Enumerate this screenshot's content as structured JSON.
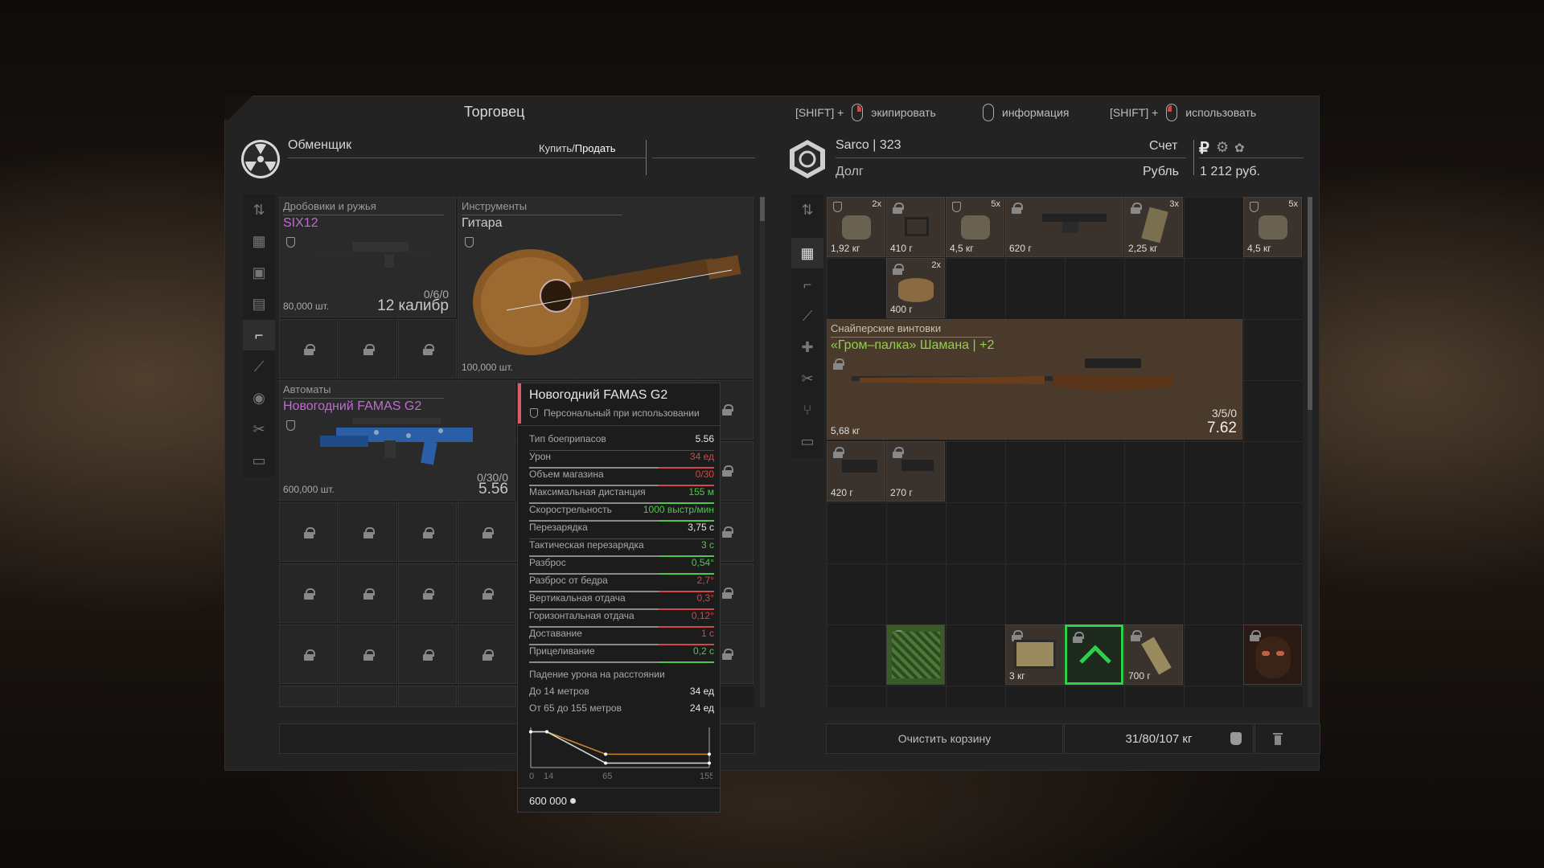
{
  "header": {
    "title": "Торговец",
    "hint1_key": "[SHIFT] +",
    "hint1_label": "экипировать",
    "hint2_label": "информация",
    "hint3_key": "[SHIFT] +",
    "hint3_label": "использовать"
  },
  "left": {
    "trader_name": "Обменщик",
    "tab_buy": "Купить",
    "tab_sep": "/",
    "tab_sell": "Продать"
  },
  "right": {
    "player": "Sarco | 323",
    "account_label": "Счет",
    "debt_label": "Долг",
    "currency": "Рубль",
    "money": "1 212 руб.",
    "currency_symbol": "₽"
  },
  "shop": [
    {
      "category": "Дробовики и ружья",
      "name": "SIX12",
      "name_color": "#c06bd0",
      "price": "80,000 шт.",
      "ammo_counts": "0/6/0",
      "caliber": "12 калибр"
    },
    {
      "category": "Инструменты",
      "name": "Гитара",
      "name_color": "#cccccc",
      "price": "100,000 шт."
    },
    {
      "category": "Автоматы",
      "name": "Новогодний FAMAS G2",
      "name_color": "#c06bd0",
      "price": "600,000 шт.",
      "ammo_counts": "0/30/0",
      "caliber": "5.56"
    }
  ],
  "tooltip": {
    "title": "Новогодний FAMAS G2",
    "subtitle": "Персональный при использовании",
    "stats": [
      {
        "label": "Тип боеприпасов",
        "value": "5.56",
        "color": "#e8e8e8",
        "bar": null
      },
      {
        "label": "Урон",
        "value": "34 ед",
        "color": "#d04848",
        "bar": "#d04848"
      },
      {
        "label": "Объем магазина",
        "value": "0/30",
        "color": "#d04848",
        "bar": "#d04848"
      },
      {
        "label": "Максимальная дистанция",
        "value": "155 м",
        "color": "#4cc84c",
        "bar": "#4cc84c"
      },
      {
        "label": "Скорострельность",
        "value": "1000 выстр/мин",
        "color": "#4cc84c",
        "bar": "#4cc84c"
      },
      {
        "label": "Перезарядка",
        "value": "3,75 с",
        "color": "#e8e8e8",
        "bar": null
      },
      {
        "label": "Тактическая перезарядка",
        "value": "3 с",
        "color": "#4cc84c",
        "bar": "#4cc84c"
      },
      {
        "label": "Разброс",
        "value": "0,54°",
        "color": "#4cc84c",
        "bar": "#4cc84c"
      },
      {
        "label": "Разброс от бедра",
        "value": "2,7°",
        "color": "#d04848",
        "bar": "#d04848"
      },
      {
        "label": "Вертикальная отдача",
        "value": "0,3°",
        "color": "#d04848",
        "bar": "#d04848"
      },
      {
        "label": "Горизонтальная отдача",
        "value": "0,12°",
        "color": "#d04848",
        "bar": "#d04848"
      },
      {
        "label": "Доставание",
        "value": "1 с",
        "color": "#d04848",
        "bar": "#d04848"
      },
      {
        "label": "Прицеливание",
        "value": "0,2 с",
        "color": "#4cc84c",
        "bar": "#4cc84c"
      }
    ],
    "falloff_title": "Падение урона на расстоянии",
    "falloff": [
      {
        "label": "До 14 метров",
        "value": "34 ед"
      },
      {
        "label": "От 65 до 155 метров",
        "value": "24 ед"
      }
    ],
    "chart_ticks": [
      "0",
      "14",
      "65",
      "155"
    ],
    "price": "600 000"
  },
  "chart_data": {
    "type": "line",
    "title": "Падение урона на расстоянии",
    "x": [
      0,
      14,
      65,
      155
    ],
    "series": [
      {
        "values": [
          34,
          34,
          24,
          24
        ]
      },
      {
        "values": [
          34,
          34,
          20,
          20
        ]
      }
    ],
    "xlim": [
      0,
      155
    ]
  },
  "inventory": {
    "items": [
      {
        "weight": "1,92 кг",
        "count": "2x"
      },
      {
        "weight": "410 г",
        "count": ""
      },
      {
        "weight": "4,5 кг",
        "count": "5x"
      },
      {
        "weight": "620 г",
        "count": ""
      },
      {
        "weight": "2,25 кг",
        "count": "3x"
      },
      {
        "weight": "4,5 кг",
        "count": "5x"
      },
      {
        "weight": "400 г",
        "count": "2x"
      },
      {
        "weight": "420 г",
        "count": ""
      },
      {
        "weight": "270 г",
        "count": ""
      },
      {
        "weight": "3 кг",
        "count": ""
      },
      {
        "weight": "700 г",
        "count": ""
      }
    ],
    "rifle": {
      "category": "Снайперские винтовки",
      "name": "«Гром–палка» Шамана | +2",
      "weight": "5,68 кг",
      "ammo_counts": "3/5/0",
      "caliber": "7.62"
    },
    "clear_label": "Очистить корзину",
    "capacity": "31/80/107 кг"
  }
}
